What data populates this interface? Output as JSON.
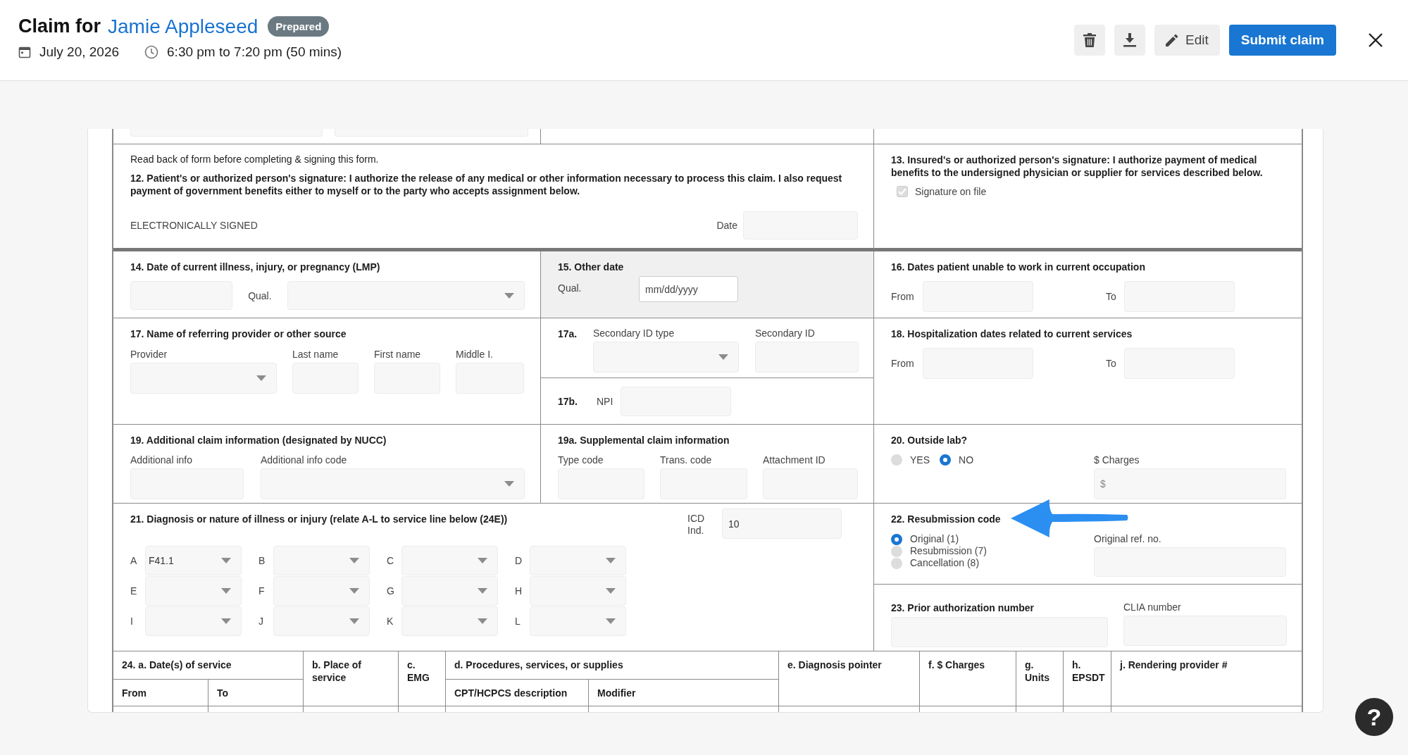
{
  "header": {
    "title": "Claim for",
    "patient_name": "Jamie Appleseed",
    "status": "Prepared",
    "date": "July 20, 2026",
    "time": "6:30 pm to 7:20 pm (50 mins)",
    "buttons": [
      {
        "kind": "delete"
      },
      {
        "kind": "download"
      },
      {
        "kind": "edit",
        "label": "Edit"
      },
      {
        "kind": "primary",
        "label": "Submit claim"
      },
      {
        "kind": "close"
      }
    ]
  },
  "form": {
    "box12": {
      "note": "Read back of form before completing & signing this form.",
      "heading": "12. Patient's or authorized person's signature: I authorize the release of any medical or other information necessary to process this claim. I also request payment of government benefits either to myself or to the party who accepts assignment below.",
      "signed": "ELECTRONICALLY SIGNED",
      "date_label": "Date"
    },
    "box13": {
      "heading": "13. Insured's or authorized person's signature: I authorize payment of medical benefits to the undersigned physician or supplier for services described below.",
      "checkbox": {
        "label": "Signature on file",
        "checked": true,
        "disabled": true
      }
    },
    "box14": {
      "heading": "14. Date of current illness, injury, or pregnancy (LMP)",
      "qual_label": "Qual."
    },
    "box15": {
      "heading": "15. Other date",
      "qual_label": "Qual.",
      "date_placeholder": "mm/dd/yyyy"
    },
    "box16": {
      "heading": "16. Dates patient unable to work in current occupation",
      "from_label": "From",
      "to_label": "To"
    },
    "box17": {
      "heading": "17. Name of referring provider or other source",
      "labels": [
        "Provider",
        "Last name",
        "First name",
        "Middle I."
      ]
    },
    "box17a": {
      "number": "17a.",
      "labels": [
        "Secondary ID type",
        "Secondary ID"
      ]
    },
    "box17b": {
      "number": "17b.",
      "label": "NPI"
    },
    "box18": {
      "heading": "18. Hospitalization dates related to current services",
      "from_label": "From",
      "to_label": "To"
    },
    "box19": {
      "heading": "19. Additional claim information (designated by NUCC)",
      "labels": [
        "Additional info",
        "Additional info code"
      ]
    },
    "box19a": {
      "heading": "19a. Supplemental claim information",
      "labels": [
        "Type code",
        "Trans. code",
        "Attachment ID"
      ]
    },
    "box20": {
      "heading": "20. Outside lab?",
      "options": [
        {
          "label": "YES",
          "selected": false
        },
        {
          "label": "NO",
          "selected": true
        }
      ],
      "charges_label": "$ Charges",
      "charges_placeholder": "$"
    },
    "box21": {
      "heading": "21. Diagnosis or nature of illness or injury (relate A-L to service line below (24E))",
      "icd_label": "ICD Ind.",
      "icd_value": "10",
      "codes": [
        {
          "letter": "A",
          "value": "F41.1"
        },
        {
          "letter": "B"
        },
        {
          "letter": "C"
        },
        {
          "letter": "D"
        },
        {
          "letter": "E"
        },
        {
          "letter": "F"
        },
        {
          "letter": "G"
        },
        {
          "letter": "H"
        },
        {
          "letter": "I"
        },
        {
          "letter": "J"
        },
        {
          "letter": "K"
        },
        {
          "letter": "L"
        }
      ]
    },
    "box22": {
      "heading": "22. Resubmission code",
      "options": [
        {
          "label": "Original (1)",
          "selected": true
        },
        {
          "label": "Resubmission (7)",
          "selected": false
        },
        {
          "label": "Cancellation (8)",
          "selected": false
        }
      ],
      "ref_label": "Original ref. no."
    },
    "box23": {
      "heading": "23. Prior authorization number",
      "clia_label": "CLIA number"
    },
    "table24": {
      "columns": [
        "24. a. Date(s) of service",
        "b. Place of service",
        "c. EMG",
        "d. Procedures, services, or supplies",
        "e. Diagnosis pointer",
        "f. $ Charges",
        "g. Units",
        "h. EPSDT",
        "j. Rendering provider #"
      ],
      "subcolumns": [
        "From",
        "To",
        "CPT/HCPCS description",
        "Modifier"
      ]
    }
  },
  "help": "?"
}
